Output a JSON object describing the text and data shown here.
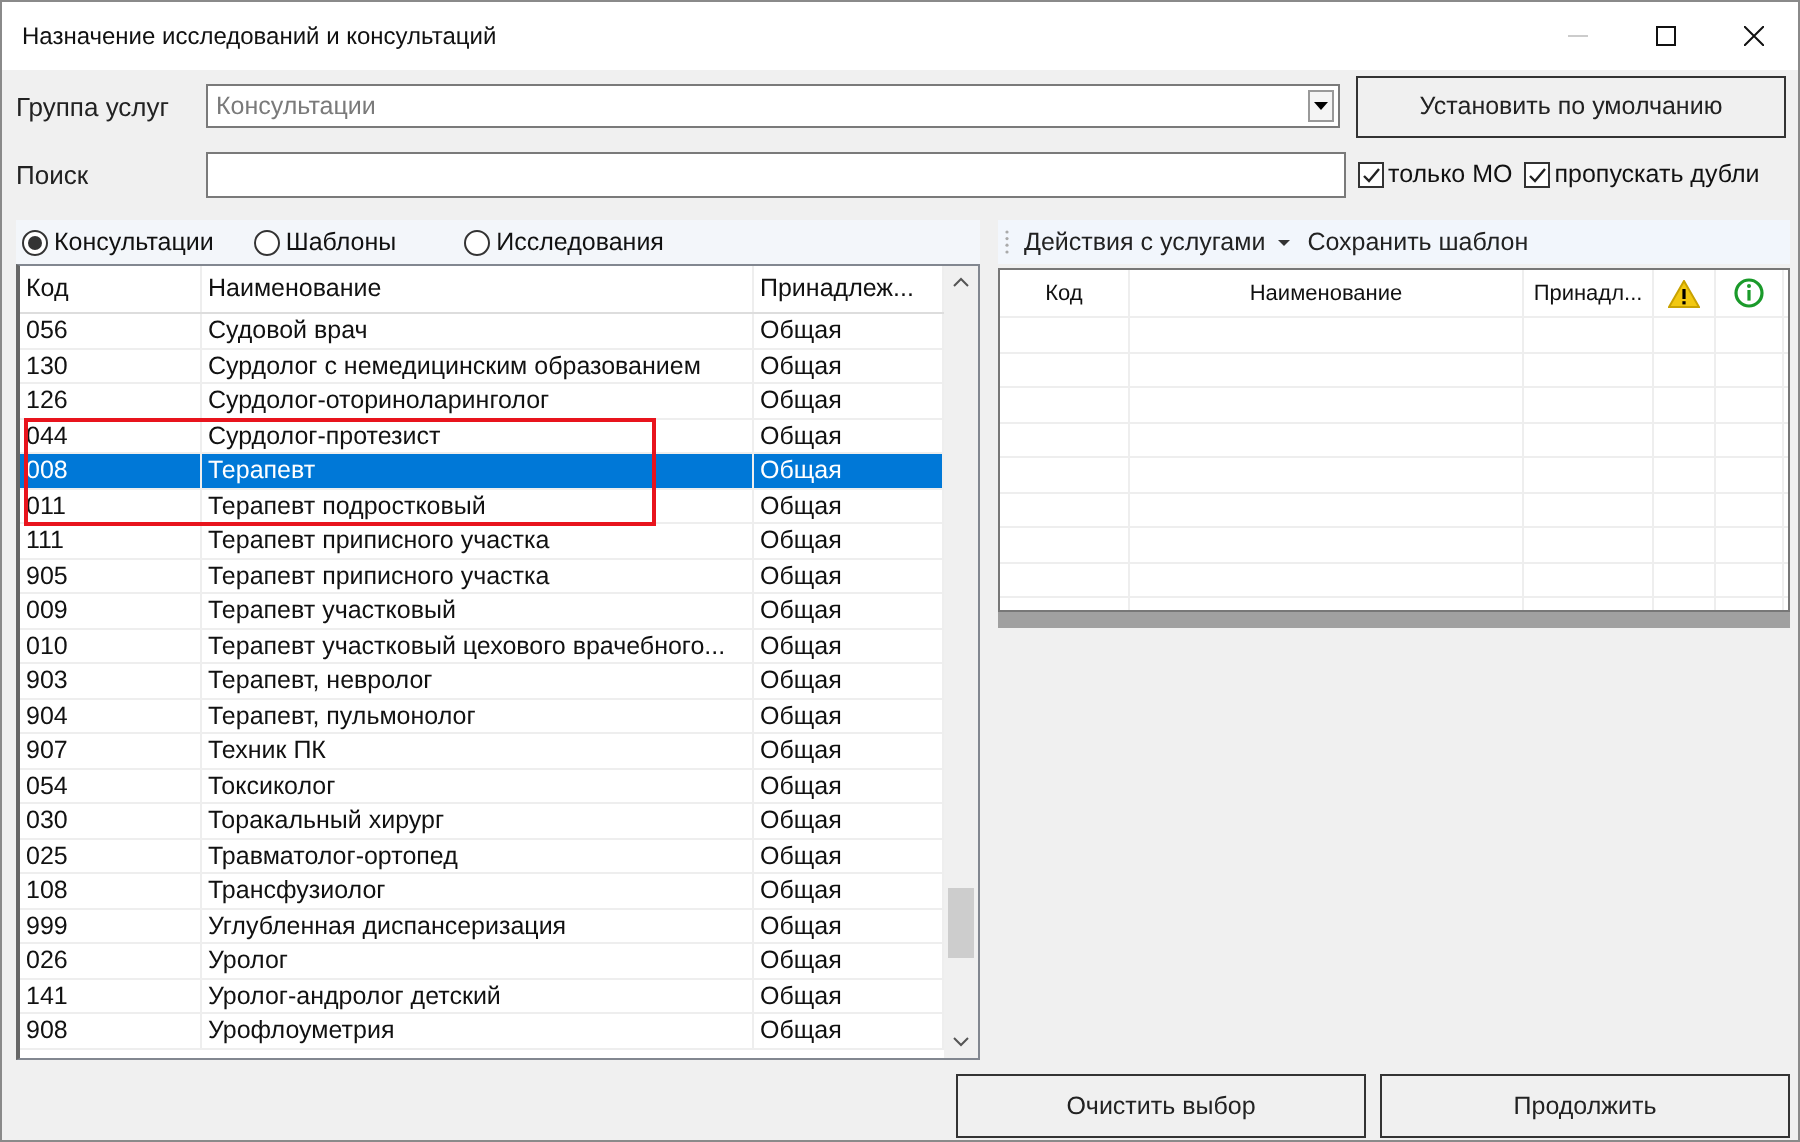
{
  "window": {
    "title": "Назначение исследований и консультаций"
  },
  "service_group": {
    "label": "Группа услуг",
    "value": "Консультации"
  },
  "default_button": "Установить по умолчанию",
  "search": {
    "label": "Поиск"
  },
  "options": [
    {
      "label": "только МО",
      "checked": true
    },
    {
      "label": "пропускать дубли",
      "checked": true
    }
  ],
  "mode": [
    {
      "label": "Консультации",
      "selected": true
    },
    {
      "label": "Шаблоны",
      "selected": false
    },
    {
      "label": "Исследования",
      "selected": false
    }
  ],
  "table": {
    "columns": [
      "Код",
      "Наименование",
      "Принадлеж..."
    ],
    "rows": [
      {
        "cells": [
          "056",
          "Судовой врач",
          "Общая"
        ],
        "selected": false
      },
      {
        "cells": [
          "130",
          "Сурдолог с немедицинским образованием",
          "Общая"
        ],
        "selected": false
      },
      {
        "cells": [
          "126",
          "Сурдолог-оториноларинголог",
          "Общая"
        ],
        "selected": false
      },
      {
        "cells": [
          "044",
          "Сурдолог-протезист",
          "Общая"
        ],
        "selected": false
      },
      {
        "cells": [
          "008",
          "Терапевт",
          "Общая"
        ],
        "selected": true
      },
      {
        "cells": [
          "011",
          "Терапевт подростковый",
          "Общая"
        ],
        "selected": false
      },
      {
        "cells": [
          "111",
          "Терапевт приписного участка",
          "Общая"
        ],
        "selected": false
      },
      {
        "cells": [
          "905",
          "Терапевт приписного участка",
          "Общая"
        ],
        "selected": false
      },
      {
        "cells": [
          "009",
          "Терапевт участковый",
          "Общая"
        ],
        "selected": false
      },
      {
        "cells": [
          "010",
          "Терапевт участковый цехового врачебного...",
          "Общая"
        ],
        "selected": false
      },
      {
        "cells": [
          "903",
          "Терапевт, невролог",
          "Общая"
        ],
        "selected": false
      },
      {
        "cells": [
          "904",
          "Терапевт, пульмонолог",
          "Общая"
        ],
        "selected": false
      },
      {
        "cells": [
          "907",
          "Техник ПК",
          "Общая"
        ],
        "selected": false
      },
      {
        "cells": [
          "054",
          "Токсиколог",
          "Общая"
        ],
        "selected": false
      },
      {
        "cells": [
          "030",
          "Торакальный хирург",
          "Общая"
        ],
        "selected": false
      },
      {
        "cells": [
          "025",
          "Травматолог-ортопед",
          "Общая"
        ],
        "selected": false
      },
      {
        "cells": [
          "108",
          "Трансфузиолог",
          "Общая"
        ],
        "selected": false
      },
      {
        "cells": [
          "999",
          "Углубленная диспансеризация",
          "Общая"
        ],
        "selected": false
      },
      {
        "cells": [
          "026",
          "Уролог",
          "Общая"
        ],
        "selected": false
      },
      {
        "cells": [
          "141",
          "Уролог-андролог детский",
          "Общая"
        ],
        "selected": false
      },
      {
        "cells": [
          "908",
          "Урофлоуметрия",
          "Общая"
        ],
        "selected": false
      }
    ]
  },
  "toolbar": [
    {
      "label": "Действия с услугами",
      "kind": "dropdown"
    },
    {
      "label": "Сохранить шаблон",
      "kind": "button"
    }
  ],
  "selected_table": {
    "columns": [
      {
        "label": "Код",
        "kind": "text"
      },
      {
        "label": "Наименование",
        "kind": "text"
      },
      {
        "label": "Принадл...",
        "kind": "text"
      },
      {
        "kind": "warning"
      },
      {
        "kind": "info"
      }
    ]
  },
  "buttons": [
    "Очистить выбор",
    "Продолжить"
  ]
}
